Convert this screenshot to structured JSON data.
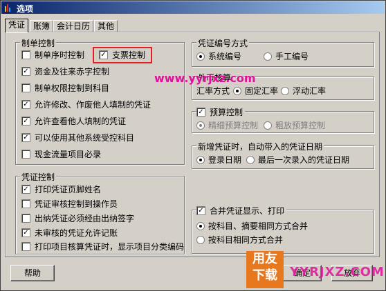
{
  "window": {
    "title": "选项"
  },
  "tabs": [
    "凭证",
    "账簿",
    "会计日历",
    "其他"
  ],
  "make_control": {
    "title": "制单控制",
    "items": [
      {
        "label": "制单序时控制",
        "checked": false
      },
      {
        "label": "支票控制",
        "checked": true
      },
      {
        "label": "资金及往来赤字控制",
        "checked": true
      },
      {
        "label": "制单权限控制到科目",
        "checked": false
      },
      {
        "label": "允许修改、作废他人填制的凭证",
        "checked": true
      },
      {
        "label": "允许查看他人填制的凭证",
        "checked": true
      },
      {
        "label": "可以使用其他系统受控科目",
        "checked": true
      },
      {
        "label": "现金流量项目必录",
        "checked": false
      }
    ]
  },
  "voucher_control": {
    "title": "凭证控制",
    "items": [
      {
        "label": "打印凭证页脚姓名",
        "checked": true
      },
      {
        "label": "凭证审核控制到操作员",
        "checked": false
      },
      {
        "label": "出纳凭证必须经由出纳签字",
        "checked": false
      },
      {
        "label": "未审核的凭证允许记账",
        "checked": true
      },
      {
        "label": "打印项目核算凭证时，显示项目分类编码",
        "checked": false
      }
    ]
  },
  "numbering": {
    "title": "凭证编号方式",
    "options": [
      "系统编号",
      "手工编号"
    ],
    "selected": 0
  },
  "fx": {
    "title": "外币核算",
    "label": "汇率方式",
    "options": [
      "固定汇率",
      "浮动汇率"
    ],
    "selected": 0
  },
  "budget": {
    "title": "预算控制",
    "checked": true,
    "options": [
      "精细预算控制",
      "粗放预算控制"
    ],
    "selected": 0
  },
  "new_date": {
    "title": "新增凭证时，自动带入的凭证日期",
    "options": [
      "登录日期",
      "最后一次录入的凭证日期"
    ],
    "selected": 0
  },
  "merge": {
    "title": "合并凭证显示、打印",
    "checked": true,
    "options": [
      "按科目、摘要相同方式合并",
      "按科目相同方式合并"
    ],
    "selected": 0
  },
  "buttons": {
    "help": "帮助",
    "ok": "确定",
    "cancel": "放弃"
  },
  "watermark": {
    "url": "www.yyrjxz.com",
    "logo_line1": "用友",
    "logo_line2": "下载",
    "brand": "YYRJXZ.COM"
  }
}
